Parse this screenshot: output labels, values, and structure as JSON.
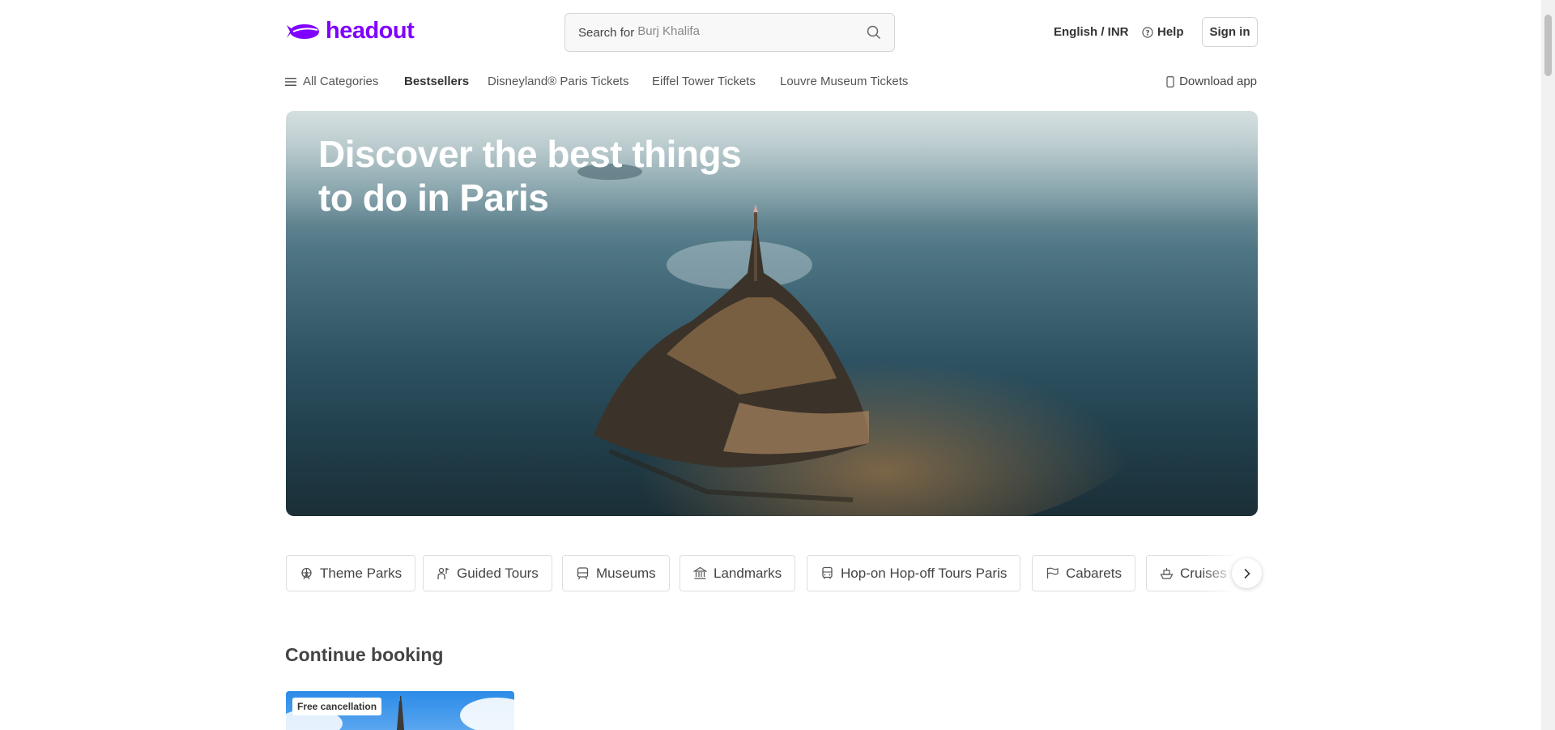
{
  "header": {
    "logo_text": "headout",
    "search": {
      "label": "Search for",
      "placeholder": "Burj Khalifa"
    },
    "language_currency": "English / INR",
    "help_label": "Help",
    "signin_label": "Sign in"
  },
  "nav": {
    "all_categories": "All Categories",
    "items": [
      {
        "label": "Bestsellers",
        "active": true
      },
      {
        "label": "Disneyland® Paris Tickets",
        "active": false
      },
      {
        "label": "Eiffel Tower Tickets",
        "active": false
      },
      {
        "label": "Louvre Museum Tickets",
        "active": false
      }
    ],
    "download_app": "Download app"
  },
  "hero": {
    "title_line1": "Discover the best things",
    "title_line2": "to do in Paris"
  },
  "categories": [
    {
      "label": "Theme Parks",
      "icon": "ferris-wheel-icon"
    },
    {
      "label": "Guided Tours",
      "icon": "guide-icon"
    },
    {
      "label": "Museums",
      "icon": "museum-icon"
    },
    {
      "label": "Landmarks",
      "icon": "landmark-icon"
    },
    {
      "label": "Hop-on Hop-off Tours Paris",
      "icon": "bus-icon"
    },
    {
      "label": "Cabarets",
      "icon": "flag-icon"
    },
    {
      "label": "Cruises",
      "icon": "ship-icon"
    }
  ],
  "continue_booking": {
    "title": "Continue booking",
    "card_badge": "Free cancellation"
  },
  "colors": {
    "brand": "#8000ff"
  }
}
